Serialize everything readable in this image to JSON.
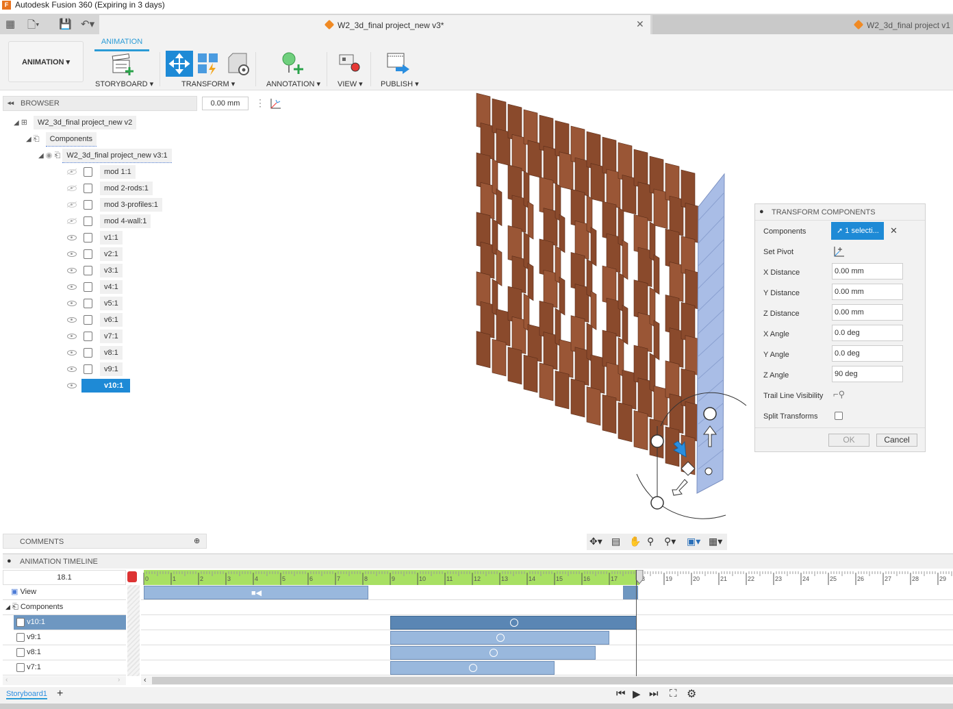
{
  "window": {
    "title": "Autodesk Fusion 360 (Expiring in 3 days)"
  },
  "tabs": [
    {
      "label": "W2_3d_final project_new v3*",
      "active": true
    },
    {
      "label": "W2_3d_final project v1",
      "active": false
    }
  ],
  "toolbar": {
    "workspace": "ANIMATION",
    "active_tab": "ANIMATION",
    "groups": [
      {
        "label": "STORYBOARD"
      },
      {
        "label": "TRANSFORM"
      },
      {
        "label": "ANNOTATION"
      },
      {
        "label": "VIEW"
      },
      {
        "label": "PUBLISH"
      }
    ]
  },
  "browser": {
    "title": "BROWSER",
    "distance": "0.00 mm",
    "root": "W2_3d_final project_new v2",
    "components_label": "Components",
    "sub": "W2_3d_final project_new v3:1",
    "items": [
      {
        "label": "mod 1:1",
        "visible": false
      },
      {
        "label": "mod 2-rods:1",
        "visible": false
      },
      {
        "label": "mod 3-profiles:1",
        "visible": false
      },
      {
        "label": "mod 4-wall:1",
        "visible": false
      },
      {
        "label": "v1:1",
        "visible": true
      },
      {
        "label": "v2:1",
        "visible": true
      },
      {
        "label": "v3:1",
        "visible": true
      },
      {
        "label": "v4:1",
        "visible": true
      },
      {
        "label": "v5:1",
        "visible": true
      },
      {
        "label": "v6:1",
        "visible": true
      },
      {
        "label": "v7:1",
        "visible": true
      },
      {
        "label": "v8:1",
        "visible": true
      },
      {
        "label": "v9:1",
        "visible": true
      },
      {
        "label": "v10:1",
        "visible": true,
        "selected": true
      }
    ]
  },
  "transform_panel": {
    "title": "TRANSFORM COMPONENTS",
    "components_label": "Components",
    "components_value": "1 selecti...",
    "set_pivot_label": "Set Pivot",
    "fields": [
      {
        "label": "X Distance",
        "value": "0.00 mm"
      },
      {
        "label": "Y Distance",
        "value": "0.00 mm"
      },
      {
        "label": "Z Distance",
        "value": "0.00 mm"
      },
      {
        "label": "X Angle",
        "value": "0.0 deg"
      },
      {
        "label": "Y Angle",
        "value": "0.0 deg"
      },
      {
        "label": "Z Angle",
        "value": "90 deg"
      }
    ],
    "trail_label": "Trail Line Visibility",
    "split_label": "Split Transforms",
    "split_checked": false,
    "ok": "OK",
    "cancel": "Cancel"
  },
  "comments": {
    "label": "COMMENTS"
  },
  "timeline": {
    "title": "ANIMATION TIMELINE",
    "current_time": "18.1",
    "ticks": [
      "0",
      "1",
      "2",
      "3",
      "4",
      "5",
      "6",
      "7",
      "8",
      "9",
      "10",
      "11",
      "12",
      "13",
      "14",
      "15",
      "16",
      "17",
      "18",
      "19",
      "20",
      "21",
      "22",
      "23",
      "24",
      "25",
      "26",
      "27",
      "28",
      "29"
    ],
    "tracks": [
      {
        "label": "View",
        "start": 0,
        "end": 8.2,
        "type": "view"
      },
      {
        "label": "Components",
        "type": "group"
      },
      {
        "label": "v10:1",
        "start": 9,
        "end": 18,
        "selected": true
      },
      {
        "label": "v9:1",
        "start": 9,
        "end": 17
      },
      {
        "label": "v8:1",
        "start": 9,
        "end": 16.5
      },
      {
        "label": "v7:1",
        "start": 9,
        "end": 15
      }
    ],
    "view_keyframe": 17.5
  },
  "storyboards": [
    {
      "label": "Storyboard1"
    }
  ],
  "colors": {
    "accent": "#2a9bd6",
    "timeline_green": "#a8e063",
    "track_bar": "#99b8dd",
    "track_selected": "#5a86b4",
    "wood": "#8a4a2c",
    "glass": "#a9bde6"
  }
}
